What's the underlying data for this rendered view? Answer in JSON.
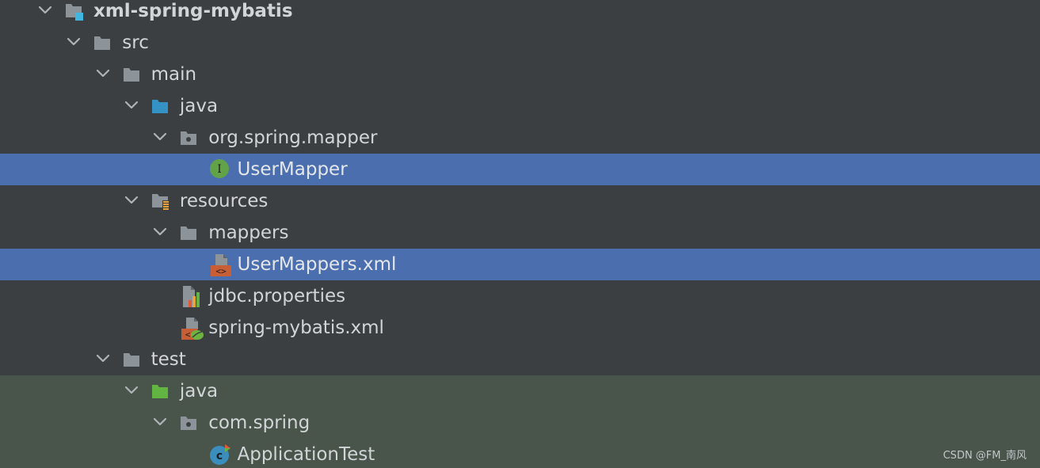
{
  "project_tree": {
    "nodes": [
      {
        "label": "xml-spring-mybatis",
        "depth": 0,
        "expanded": true,
        "icon": "module-folder-icon",
        "bold": true
      },
      {
        "label": "src",
        "depth": 1,
        "expanded": true,
        "icon": "folder-icon"
      },
      {
        "label": "main",
        "depth": 2,
        "expanded": true,
        "icon": "folder-icon"
      },
      {
        "label": "java",
        "depth": 3,
        "expanded": true,
        "icon": "source-root-folder-icon"
      },
      {
        "label": "org.spring.mapper",
        "depth": 4,
        "expanded": true,
        "icon": "package-icon"
      },
      {
        "label": "UserMapper",
        "depth": 5,
        "icon": "java-interface-icon",
        "selected": true
      },
      {
        "label": "resources",
        "depth": 3,
        "expanded": true,
        "icon": "resources-root-folder-icon"
      },
      {
        "label": "mappers",
        "depth": 4,
        "expanded": true,
        "icon": "folder-icon"
      },
      {
        "label": "UserMappers.xml",
        "depth": 5,
        "icon": "xml-file-icon",
        "selected": true
      },
      {
        "label": "jdbc.properties",
        "depth": 4,
        "icon": "properties-file-icon"
      },
      {
        "label": "spring-mybatis.xml",
        "depth": 4,
        "icon": "spring-xml-file-icon"
      },
      {
        "label": "test",
        "depth": 2,
        "expanded": true,
        "icon": "folder-icon"
      },
      {
        "label": "java",
        "depth": 3,
        "expanded": true,
        "icon": "test-root-folder-icon",
        "test": true
      },
      {
        "label": "com.spring",
        "depth": 4,
        "expanded": true,
        "icon": "package-icon",
        "test": true
      },
      {
        "label": "ApplicationTest",
        "depth": 5,
        "icon": "java-class-icon",
        "test": true
      }
    ]
  },
  "colors": {
    "background": "#3c3f41",
    "selection": "#4b6eaf",
    "test_area": "#49544a",
    "text": "#d2d5d8",
    "folder": "#8c9399",
    "source_root": "#3592c4",
    "test_root": "#62b543",
    "xml": "#c75e36",
    "interface_green": "#62a349"
  },
  "watermark": "CSDN @FM_南风"
}
